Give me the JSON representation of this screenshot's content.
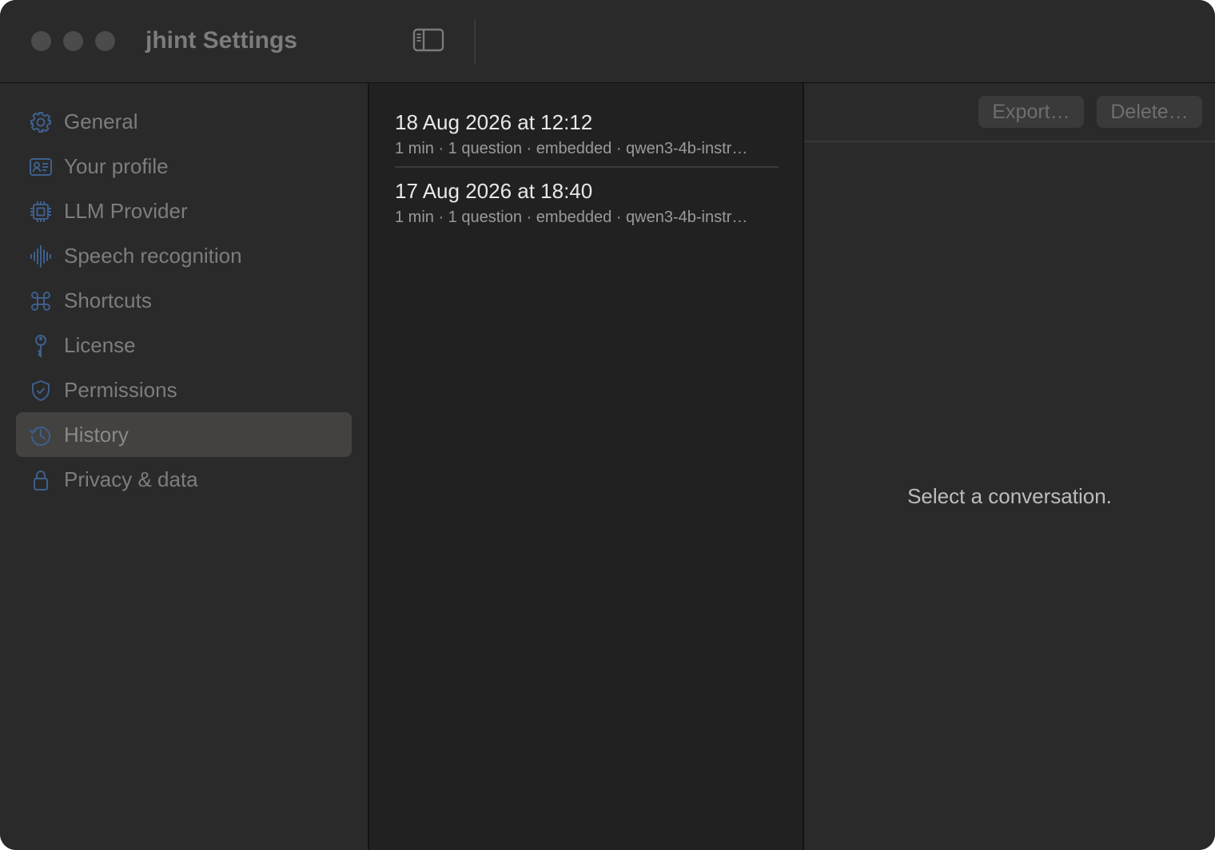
{
  "window": {
    "title": "jhint Settings"
  },
  "sidebar": {
    "items": [
      {
        "label": "General",
        "icon": "gear-icon"
      },
      {
        "label": "Your profile",
        "icon": "person-card-icon"
      },
      {
        "label": "LLM Provider",
        "icon": "cpu-icon"
      },
      {
        "label": "Speech recognition",
        "icon": "waveform-icon"
      },
      {
        "label": "Shortcuts",
        "icon": "command-icon"
      },
      {
        "label": "License",
        "icon": "key-icon"
      },
      {
        "label": "Permissions",
        "icon": "shield-check-icon"
      },
      {
        "label": "History",
        "icon": "clock-history-icon",
        "selected": true
      },
      {
        "label": "Privacy & data",
        "icon": "lock-icon"
      }
    ]
  },
  "history": {
    "conversations": [
      {
        "title": "18 Aug 2026 at 12:12",
        "meta": "1 min · 1 question · embedded · qwen3-4b-instr…"
      },
      {
        "title": "17 Aug 2026 at 18:40",
        "meta": "1 min · 1 question · embedded · qwen3-4b-instr…"
      }
    ]
  },
  "detail": {
    "export_label": "Export…",
    "delete_label": "Delete…",
    "empty_message": "Select a conversation."
  },
  "colors": {
    "accent_icon": "#3e5f8c",
    "window_bg": "#2a2a2a",
    "list_bg": "#212121",
    "selected_bg": "#434240"
  }
}
